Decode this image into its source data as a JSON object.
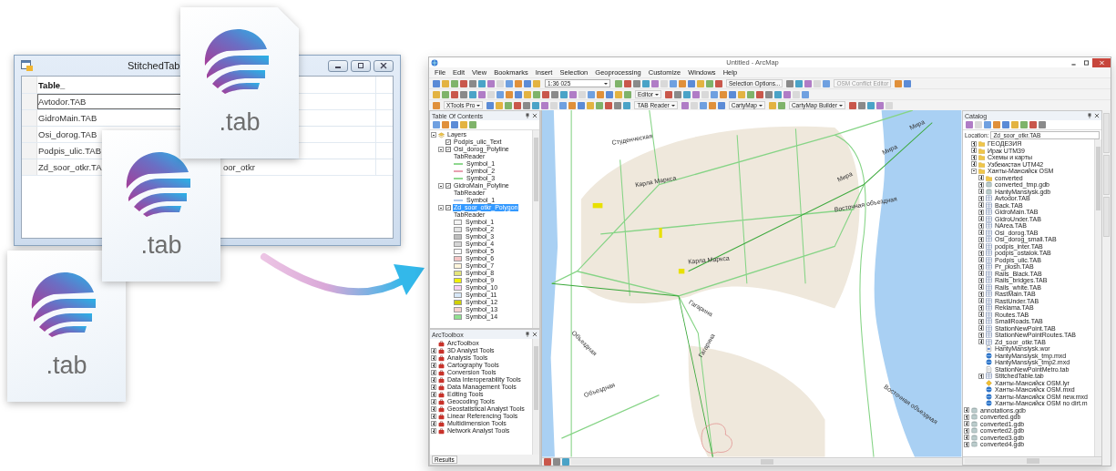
{
  "stitched_window": {
    "title": "StitchedTab",
    "columns": [
      "Table_"
    ],
    "rows": [
      {
        "cells": [
          "Avtodor.TAB"
        ],
        "selected": true
      },
      {
        "cells": [
          "GidroMain.TAB"
        ],
        "selected": false
      },
      {
        "cells": [
          "Osi_dorog.TAB"
        ],
        "selected": false
      },
      {
        "cells": [
          "Podpis_ulic.TAB"
        ],
        "selected": false
      },
      {
        "cells": [
          "Zd_soor_otkr.TA",
          "oor_otkr"
        ],
        "selected": false
      }
    ]
  },
  "file_icons": [
    {
      "label": ".tab"
    },
    {
      "label": ".tab"
    },
    {
      "label": ".tab"
    }
  ],
  "arcmap": {
    "title": "Untitled - ArcMap",
    "menu": [
      "File",
      "Edit",
      "View",
      "Bookmarks",
      "Insert",
      "Selection",
      "Geoprocessing",
      "Customize",
      "Windows",
      "Help"
    ],
    "toolbars": [
      [
        {
          "kind": "field",
          "text": "1:36 025"
        },
        {
          "kind": "label",
          "text": "Selection Options...",
          "disabled": false
        },
        {
          "kind": "label",
          "text": "OSM Conflict Editor",
          "disabled": true
        }
      ],
      [
        {
          "kind": "menu",
          "text": "Editor"
        }
      ],
      [
        {
          "kind": "menu",
          "text": "XTools Pro"
        },
        {
          "kind": "menu",
          "text": "TAB Reader"
        },
        {
          "kind": "menu",
          "text": "CartyMap"
        },
        {
          "kind": "menu",
          "text": "CartyMap Builder"
        }
      ]
    ],
    "toc": {
      "title": "Table Of Contents",
      "tree": [
        {
          "label": "Layers",
          "kind": "layers",
          "expanded": true,
          "children": [
            {
              "label": "Podpis_ulic_Text",
              "checked": true,
              "selected": false
            },
            {
              "label": "Osi_dorog_Polyline",
              "checked": true,
              "expanded": true,
              "selected": false,
              "children": [
                {
                  "label": "TabReader"
                },
                {
                  "label": "Symbol_1",
                  "kind": "line",
                  "color": "#8fd88f"
                },
                {
                  "label": "Symbol_2",
                  "kind": "line",
                  "color": "#e8a0b0"
                },
                {
                  "label": "Symbol_3",
                  "kind": "line",
                  "color": "#8fd88f"
                }
              ]
            },
            {
              "label": "GidroMain_Polyline",
              "checked": true,
              "expanded": true,
              "selected": false,
              "children": [
                {
                  "label": "TabReader"
                },
                {
                  "label": "Symbol_1",
                  "kind": "line",
                  "color": "#b0c8e8"
                }
              ]
            },
            {
              "label": "Zd_soor_otkr_Polygon",
              "checked": true,
              "expanded": true,
              "selected": true,
              "children": [
                {
                  "label": "TabReader"
                },
                {
                  "label": "Symbol_1",
                  "kind": "fill",
                  "color": "#f4f4f4"
                },
                {
                  "label": "Symbol_2",
                  "kind": "fill",
                  "color": "#e4e4e4"
                },
                {
                  "label": "Symbol_3",
                  "kind": "fill",
                  "color": "#bdbdbd"
                },
                {
                  "label": "Symbol_4",
                  "kind": "fill",
                  "color": "#d6d6d6"
                },
                {
                  "label": "Symbol_5",
                  "kind": "fill",
                  "color": "#fafafa"
                },
                {
                  "label": "Symbol_6",
                  "kind": "fill",
                  "color": "#f4c4c4"
                },
                {
                  "label": "Symbol_7",
                  "kind": "fill",
                  "color": "#fff6dc"
                },
                {
                  "label": "Symbol_8",
                  "kind": "fill",
                  "color": "#e4e47c"
                },
                {
                  "label": "Symbol_9",
                  "kind": "fill",
                  "color": "#f0f000"
                },
                {
                  "label": "Symbol_10",
                  "kind": "fill",
                  "color": "#f6d0f2"
                },
                {
                  "label": "Symbol_11",
                  "kind": "fill",
                  "color": "#d8e8f8"
                },
                {
                  "label": "Symbol_12",
                  "kind": "fill",
                  "color": "#d0d000"
                },
                {
                  "label": "Symbol_13",
                  "kind": "fill",
                  "color": "#f8d0d0"
                },
                {
                  "label": "Symbol_14",
                  "kind": "fill",
                  "color": "#90e090"
                }
              ]
            }
          ]
        }
      ]
    },
    "toolbox": {
      "title": "ArcToolbox",
      "tree": [
        {
          "label": "ArcToolbox",
          "kind": "toolbox"
        },
        {
          "label": "3D Analyst Tools",
          "kind": "toolbox",
          "expanded": false
        },
        {
          "label": "Analysis Tools",
          "kind": "toolbox",
          "expanded": false
        },
        {
          "label": "Cartography Tools",
          "kind": "toolbox",
          "expanded": false
        },
        {
          "label": "Conversion Tools",
          "kind": "toolbox",
          "expanded": false
        },
        {
          "label": "Data Interoperability Tools",
          "kind": "toolbox",
          "expanded": false
        },
        {
          "label": "Data Management Tools",
          "kind": "toolbox",
          "expanded": false
        },
        {
          "label": "Editing Tools",
          "kind": "toolbox",
          "expanded": false
        },
        {
          "label": "Geocoding Tools",
          "kind": "toolbox",
          "expanded": false
        },
        {
          "label": "Geostatistical Analyst Tools",
          "kind": "toolbox",
          "expanded": false
        },
        {
          "label": "Linear Referencing Tools",
          "kind": "toolbox",
          "expanded": false
        },
        {
          "label": "Multidimension Tools",
          "kind": "toolbox",
          "expanded": false
        },
        {
          "label": "Network Analyst Tools",
          "kind": "toolbox",
          "expanded": false
        }
      ],
      "tab": "Results"
    },
    "map": {
      "labels": [
        "Студенческая",
        "Мира",
        "Мира",
        "Мира",
        "Восточная объездная",
        "Восточная объездная",
        "Карла Маркса",
        "Карла Маркса",
        "Гагарина",
        "Гагарина",
        "Объездная",
        "Объездная"
      ]
    },
    "catalog": {
      "title": "Catalog",
      "location_label": "Location:",
      "location": "Zd_soor_otkr.TAB",
      "tree": [
        {
          "children": [
            {
              "label": "ГЕОДЕЗИЯ",
              "kind": "folder",
              "expanded": false
            },
            {
              "label": "Ирак UTM39",
              "kind": "folder",
              "expanded": false
            },
            {
              "label": "Схемы и карты",
              "kind": "folder",
              "expanded": false
            },
            {
              "label": "Узбекистан UTM42",
              "kind": "folder",
              "expanded": false
            },
            {
              "label": "Ханты-Мансийск OSM",
              "kind": "folder",
              "expanded": true,
              "children": [
                {
                  "label": "converted",
                  "kind": "folder",
                  "expanded": false
                },
                {
                  "label": "converted_tmp.gdb",
                  "kind": "gdb",
                  "expanded": false
                },
                {
                  "label": "HantyMansiysk.gdb",
                  "kind": "gdb",
                  "expanded": false
                },
                {
                  "label": "Avtodor.TAB",
                  "kind": "tab",
                  "expanded": false
                },
                {
                  "label": "Back.TAB",
                  "kind": "tab",
                  "expanded": false
                },
                {
                  "label": "GidroMain.TAB",
                  "kind": "tab",
                  "expanded": false
                },
                {
                  "label": "GidroUnder.TAB",
                  "kind": "tab",
                  "expanded": false
                },
                {
                  "label": "NArea.TAB",
                  "kind": "tab",
                  "expanded": false
                },
                {
                  "label": "Osi_dorog.TAB",
                  "kind": "tab",
                  "expanded": false
                },
                {
                  "label": "Osi_dorog_small.TAB",
                  "kind": "tab",
                  "expanded": false
                },
                {
                  "label": "podpis_inter.TAB",
                  "kind": "tab",
                  "expanded": false
                },
                {
                  "label": "podpis_ostalok.TAB",
                  "kind": "tab",
                  "expanded": false
                },
                {
                  "label": "Podpis_ulic.TAB",
                  "kind": "tab",
                  "expanded": false
                },
                {
                  "label": "Pr_plosh.TAB",
                  "kind": "tab",
                  "expanded": false
                },
                {
                  "label": "Rails_Black.TAB",
                  "kind": "tab",
                  "expanded": false
                },
                {
                  "label": "Rails_bridges.TAB",
                  "kind": "tab",
                  "expanded": false
                },
                {
                  "label": "Rails_white.TAB",
                  "kind": "tab",
                  "expanded": false
                },
                {
                  "label": "RastMain.TAB",
                  "kind": "tab",
                  "expanded": false
                },
                {
                  "label": "RastUnder.TAB",
                  "kind": "tab",
                  "expanded": false
                },
                {
                  "label": "Reklama.TAB",
                  "kind": "tab",
                  "expanded": false
                },
                {
                  "label": "Routes.TAB",
                  "kind": "tab",
                  "expanded": false
                },
                {
                  "label": "SmallRoads.TAB",
                  "kind": "tab",
                  "expanded": false
                },
                {
                  "label": "StationNewPoint.TAB",
                  "kind": "tab",
                  "expanded": false
                },
                {
                  "label": "StationNewPointRoutes.TAB",
                  "kind": "tab",
                  "expanded": false
                },
                {
                  "label": "Zd_soor_otkr.TAB",
                  "kind": "tab",
                  "expanded": false
                },
                {
                  "label": "HantyMansiysk.wor",
                  "kind": "wor"
                },
                {
                  "label": "HantyMansiysk_tmp.mxd",
                  "kind": "mxd"
                },
                {
                  "label": "HantyMansiysk_tmp2.mxd",
                  "kind": "mxd"
                },
                {
                  "label": "StationNewPointMetro.tab",
                  "kind": "doc"
                },
                {
                  "label": "StitchedTable.tab",
                  "kind": "tab",
                  "expanded": false
                },
                {
                  "label": "Ханты-Мансийск OSM.lyr",
                  "kind": "lyr"
                },
                {
                  "label": "Ханты-Мансийск OSM.mxd",
                  "kind": "mxd"
                },
                {
                  "label": "Ханты-Мансийск OSM new.mxd",
                  "kind": "mxd"
                },
                {
                  "label": "Ханты-Мансийск OSM no dirt.m",
                  "kind": "mxd"
                }
              ]
            }
          ]
        },
        {
          "label": "annotations.gdb",
          "kind": "gdb",
          "expanded": false
        },
        {
          "label": "converted.gdb",
          "kind": "gdb",
          "expanded": false
        },
        {
          "label": "converted1.gdb",
          "kind": "gdb",
          "expanded": false
        },
        {
          "label": "converted2.gdb",
          "kind": "gdb",
          "expanded": false
        },
        {
          "label": "converted3.gdb",
          "kind": "gdb",
          "expanded": false
        },
        {
          "label": "converted4.gdb",
          "kind": "gdb",
          "expanded": false
        }
      ]
    }
  }
}
